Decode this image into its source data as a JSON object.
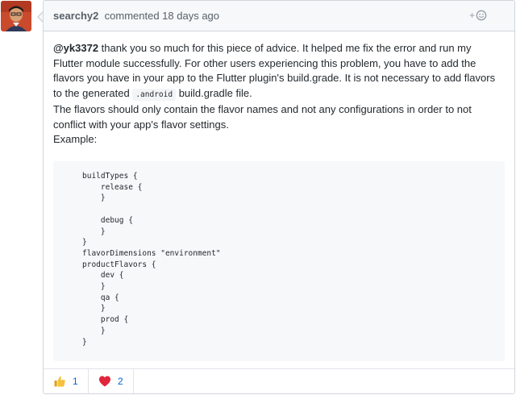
{
  "comment": {
    "author": "searchy2",
    "meta": "commented 18 days ago",
    "mention": "@yk3372",
    "paragraph1_a": " thank you so much for this piece of advice. It helped me fix the error and run my Flutter module successfully. For other users experiencing this problem, you have to add the flavors you have in your app to the Flutter plugin's build.grade. It is not necessary to add flavors to the generated ",
    "inline_code": ".android",
    "paragraph1_b": " build.gradle file.",
    "paragraph2": "The flavors should only contain the flavor names and not any configurations in order to not conflict with your app's flavor settings.",
    "example_label": "Example:",
    "code": "buildTypes {\n    release {\n    }\n\n    debug {\n    }\n}\nflavorDimensions \"environment\"\nproductFlavors {\n    dev {\n    }\n    qa {\n    }\n    prod {\n    }\n}"
  },
  "header_actions": {
    "add_reaction_plus": "+",
    "add_reaction_icon": "smiley-icon"
  },
  "reactions": [
    {
      "icon": "thumbs-up-icon",
      "count": "1"
    },
    {
      "icon": "heart-icon",
      "count": "2"
    }
  ],
  "colors": {
    "header_bg": "#f6f8fa",
    "border": "#d1d5da",
    "link_blue": "#0366d6"
  }
}
